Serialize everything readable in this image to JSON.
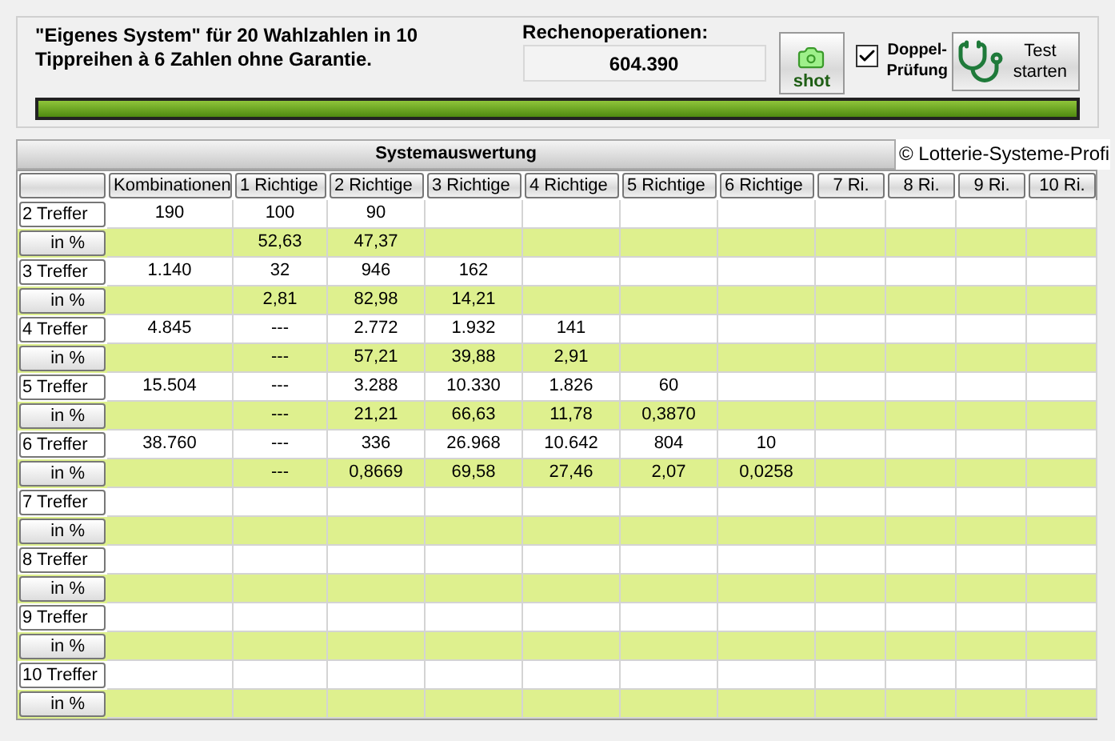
{
  "header": {
    "description": "\"Eigenes System\" für 20 Wahlzahlen in 10 Tippreihen à 6 Zahlen ohne Garantie.",
    "operations_label": "Rechenoperationen:",
    "operations_value": "604.390",
    "shot_button": "shot",
    "double_check": {
      "label": "Doppel-Prüfung",
      "checked": true
    },
    "test_button": "Test starten",
    "progress": {
      "level": 1
    }
  },
  "table": {
    "title": "Systemauswertung",
    "copyright": "© Lotterie-Systeme-Profi",
    "columns": [
      "Kombinationen",
      "1 Richtige",
      "2 Richtige",
      "3 Richtige",
      "4 Richtige",
      "5 Richtige",
      "6 Richtige",
      "7 Ri.",
      "8 Ri.",
      "9 Ri.",
      "10 Ri."
    ],
    "rows": [
      {
        "label": "2 Treffer",
        "kind": "count",
        "cells": [
          "190",
          "100",
          "90",
          null,
          null,
          null,
          null,
          null,
          null,
          null,
          null
        ]
      },
      {
        "label": "in %",
        "kind": "percent",
        "cells": [
          null,
          "52,63",
          "47,37",
          null,
          null,
          null,
          null,
          null,
          null,
          null,
          null
        ]
      },
      {
        "label": "3 Treffer",
        "kind": "count",
        "cells": [
          "1.140",
          "32",
          "946",
          "162",
          null,
          null,
          null,
          null,
          null,
          null,
          null
        ]
      },
      {
        "label": "in %",
        "kind": "percent",
        "cells": [
          null,
          "2,81",
          "82,98",
          "14,21",
          null,
          null,
          null,
          null,
          null,
          null,
          null
        ]
      },
      {
        "label": "4 Treffer",
        "kind": "count",
        "cells": [
          "4.845",
          "---",
          "2.772",
          "1.932",
          "141",
          null,
          null,
          null,
          null,
          null,
          null
        ]
      },
      {
        "label": "in %",
        "kind": "percent",
        "cells": [
          null,
          "---",
          "57,21",
          "39,88",
          "2,91",
          null,
          null,
          null,
          null,
          null,
          null
        ]
      },
      {
        "label": "5 Treffer",
        "kind": "count",
        "cells": [
          "15.504",
          "---",
          "3.288",
          "10.330",
          "1.826",
          "60",
          null,
          null,
          null,
          null,
          null
        ]
      },
      {
        "label": "in %",
        "kind": "percent",
        "cells": [
          null,
          "---",
          "21,21",
          "66,63",
          "11,78",
          "0,3870",
          null,
          null,
          null,
          null,
          null
        ]
      },
      {
        "label": "6 Treffer",
        "kind": "count",
        "cells": [
          "38.760",
          "---",
          "336",
          "26.968",
          "10.642",
          "804",
          "10",
          null,
          null,
          null,
          null
        ]
      },
      {
        "label": "in %",
        "kind": "percent",
        "cells": [
          null,
          "---",
          "0,8669",
          "69,58",
          "27,46",
          "2,07",
          "0,0258",
          null,
          null,
          null,
          null
        ]
      },
      {
        "label": "7 Treffer",
        "kind": "count",
        "cells": [
          null,
          null,
          null,
          null,
          null,
          null,
          null,
          null,
          null,
          null,
          null
        ]
      },
      {
        "label": "in %",
        "kind": "percent",
        "cells": [
          null,
          null,
          null,
          null,
          null,
          null,
          null,
          null,
          null,
          null,
          null
        ]
      },
      {
        "label": "8 Treffer",
        "kind": "count",
        "cells": [
          null,
          null,
          null,
          null,
          null,
          null,
          null,
          null,
          null,
          null,
          null
        ]
      },
      {
        "label": "in %",
        "kind": "percent",
        "cells": [
          null,
          null,
          null,
          null,
          null,
          null,
          null,
          null,
          null,
          null,
          null
        ]
      },
      {
        "label": "9 Treffer",
        "kind": "count",
        "cells": [
          null,
          null,
          null,
          null,
          null,
          null,
          null,
          null,
          null,
          null,
          null
        ]
      },
      {
        "label": "in %",
        "kind": "percent",
        "cells": [
          null,
          null,
          null,
          null,
          null,
          null,
          null,
          null,
          null,
          null,
          null
        ]
      },
      {
        "label": "10 Treffer",
        "kind": "count",
        "cells": [
          null,
          null,
          null,
          null,
          null,
          null,
          null,
          null,
          null,
          null,
          null
        ]
      },
      {
        "label": "in %",
        "kind": "percent",
        "cells": [
          null,
          null,
          null,
          null,
          null,
          null,
          null,
          null,
          null,
          null,
          null
        ]
      }
    ]
  }
}
